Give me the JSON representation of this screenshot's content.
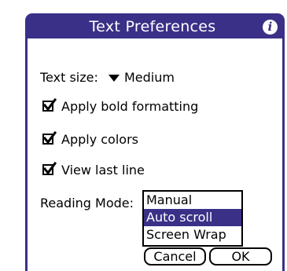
{
  "dialog": {
    "title": "Text Preferences",
    "info_icon": "info-icon",
    "accent_color": "#3a3088"
  },
  "text_size": {
    "label": "Text size:",
    "value": "Medium"
  },
  "options": [
    {
      "label": "Apply bold formatting",
      "checked": true
    },
    {
      "label": "Apply colors",
      "checked": true
    },
    {
      "label": "View last line",
      "checked": true
    }
  ],
  "reading_mode": {
    "label": "Reading Mode:",
    "items": [
      "Manual",
      "Auto scroll",
      "Screen Wrap"
    ],
    "selected": "Auto scroll"
  },
  "buttons": {
    "cancel": "Cancel",
    "ok": "OK"
  }
}
